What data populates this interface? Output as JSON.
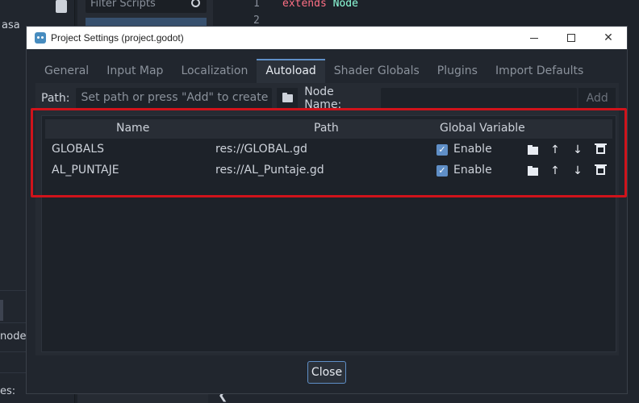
{
  "background": {
    "partial_text_top": "asa",
    "filter_placeholder": "Filter Scripts",
    "code_lines": [
      {
        "num": "1",
        "keyword": "extends",
        "type": "Node"
      },
      {
        "num": "2"
      }
    ],
    "partial_text_node": "node.",
    "partial_text_bottom": "es:",
    "chevron": "❮"
  },
  "dialog": {
    "title": "Project Settings (project.godot)",
    "window_controls": {
      "minimize": "minimize",
      "maximize": "maximize",
      "close": "✕"
    },
    "tabs": [
      {
        "label": "General",
        "active": false
      },
      {
        "label": "Input Map",
        "active": false
      },
      {
        "label": "Localization",
        "active": false
      },
      {
        "label": "Autoload",
        "active": true
      },
      {
        "label": "Shader Globals",
        "active": false
      },
      {
        "label": "Plugins",
        "active": false
      },
      {
        "label": "Import Defaults",
        "active": false
      }
    ],
    "autoload": {
      "path_label": "Path:",
      "path_placeholder": "Set path or press \"Add\" to create a",
      "node_name_label": "Node Name:",
      "node_name_value": "",
      "add_label": "Add",
      "columns": {
        "name": "Name",
        "path": "Path",
        "global": "Global Variable"
      },
      "rows": [
        {
          "name": "GLOBALS",
          "path": "res://GLOBAL.gd",
          "enabled": true,
          "enable_label": "Enable"
        },
        {
          "name": "AL_PUNTAJE",
          "path": "res://AL_Puntaje.gd",
          "enabled": true,
          "enable_label": "Enable"
        }
      ]
    },
    "close_label": "Close"
  },
  "colors": {
    "accent": "#5f8fc7",
    "highlight_box": "#d0131b",
    "panel_bg": "#262b33"
  }
}
